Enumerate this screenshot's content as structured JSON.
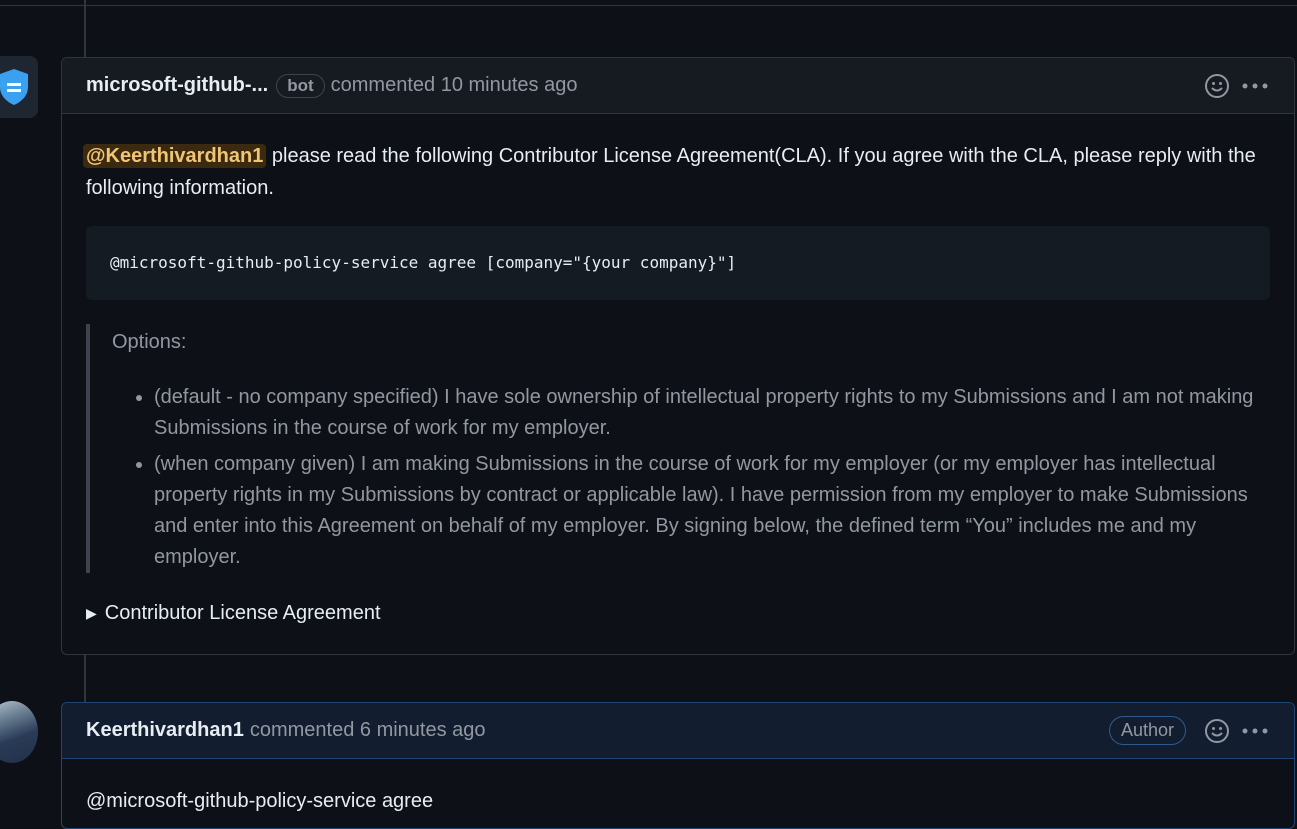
{
  "comment1": {
    "author": "microsoft-github-...",
    "badge": "bot",
    "meta": "commented 10 minutes ago",
    "mention": "@Keerthivardhan1",
    "intro": " please read the following Contributor License Agreement(CLA). If you agree with the CLA, please reply with the following information.",
    "code": "@microsoft-github-policy-service agree [company=\"{your company}\"]",
    "options_title": "Options:",
    "options": [
      "(default - no company specified) I have sole ownership of intellectual property rights to my Submissions and I am not making Submissions in the course of work for my employer.",
      "(when company given) I am making Submissions in the course of work for my employer (or my employer has intellectual property rights in my Submissions by contract or applicable law). I have permission from my employer to make Submissions and enter into this Agreement on behalf of my employer. By signing below, the defined term “You” includes me and my employer."
    ],
    "details_label": "Contributor License Agreement"
  },
  "comment2": {
    "author": "Keerthivardhan1",
    "meta": "commented 6 minutes ago",
    "badge": "Author",
    "body": "@microsoft-github-policy-service agree"
  },
  "icons": [
    "shield-icon",
    "smiley-icon",
    "kebab-icon",
    "triangle-right-icon"
  ],
  "colors": {
    "background": "#0d1117",
    "header": "#161b22",
    "mention_bg": "#3b2a10",
    "mention_fg": "#f0c674",
    "author_border": "#1f4675"
  }
}
